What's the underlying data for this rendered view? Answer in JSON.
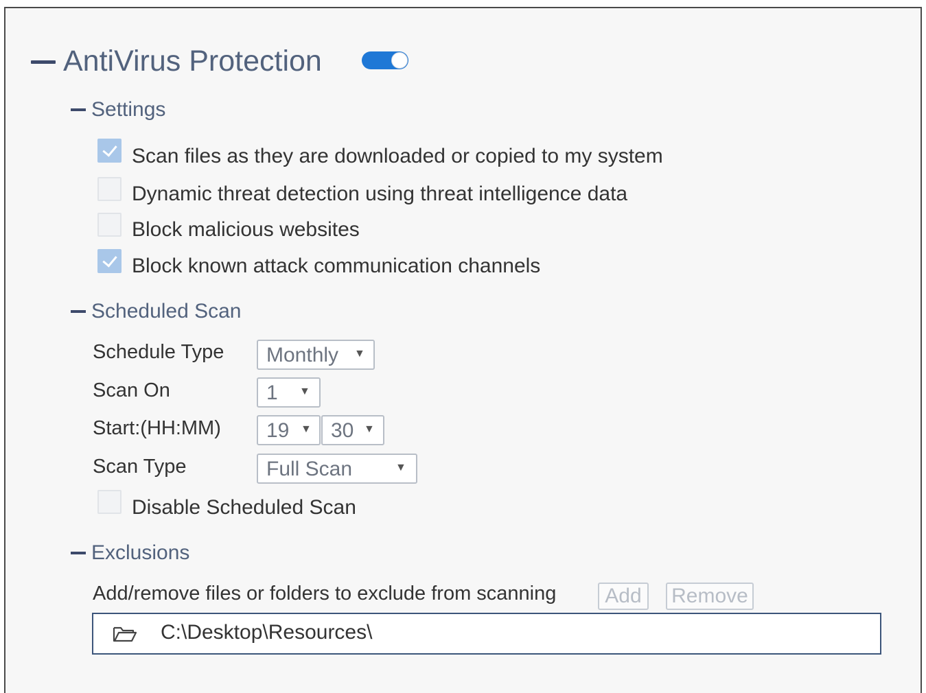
{
  "header": {
    "title": "AntiVirus Protection",
    "toggle_on": true
  },
  "settings": {
    "title": "Settings",
    "items": [
      {
        "label": "Scan files as they are downloaded or copied to my system",
        "checked": true
      },
      {
        "label": "Dynamic threat detection using threat intelligence data",
        "checked": false
      },
      {
        "label": "Block malicious websites",
        "checked": false
      },
      {
        "label": "Block known attack communication channels",
        "checked": true
      }
    ]
  },
  "scheduled_scan": {
    "title": "Scheduled Scan",
    "schedule_type_label": "Schedule Type",
    "schedule_type_value": "Monthly",
    "scan_on_label": "Scan On",
    "scan_on_value": "1",
    "start_label": "Start:(HH:MM)",
    "start_hour": "19",
    "start_minute": "30",
    "scan_type_label": "Scan Type",
    "scan_type_value": "Full Scan",
    "disable_label": "Disable Scheduled Scan",
    "disable_checked": false
  },
  "exclusions": {
    "title": "Exclusions",
    "description": "Add/remove files or folders to exclude from scanning",
    "add_label": "Add",
    "remove_label": "Remove",
    "paths": [
      "C:\\Desktop\\Resources\\"
    ]
  },
  "icons": {
    "collapse": "minus-icon",
    "caret": "caret-down-icon",
    "folder": "folder-open-icon",
    "check": "check-icon"
  },
  "colors": {
    "accent": "#1f78d6",
    "heading": "#52627d",
    "checked": "#a9c7e9"
  }
}
